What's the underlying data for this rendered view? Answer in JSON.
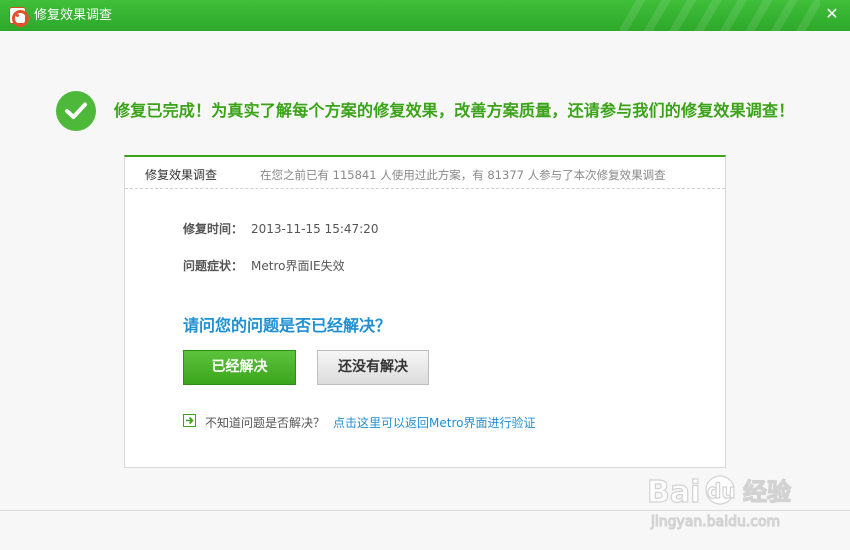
{
  "window": {
    "title": "修复效果调查",
    "close_glyph": "✕"
  },
  "banner": {
    "message": "修复已完成！为真实了解每个方案的修复效果，改善方案质量，还请参与我们的修复效果调查！"
  },
  "survey": {
    "title": "修复效果调查",
    "stats": "在您之前已有 115841 人使用过此方案，有 81377 人参与了本次修复效果调查",
    "repair_time_label": "修复时间：",
    "repair_time_value": "2013-11-15 15:47:20",
    "symptom_label": "问题症状：",
    "symptom_value": "Metro界面IE失效",
    "question": "请问您的问题是否已经解决？",
    "solved_button": "已经解决",
    "not_solved_button": "还没有解决",
    "help_text": "不知道问题是否解决？",
    "help_link": "点击这里可以返回Metro界面进行验证"
  },
  "colors": {
    "title_bar": "#33b02e",
    "success_green": "#3aa318",
    "link_blue": "#1f8fd4"
  },
  "icons": {
    "app": "lifebuoy-icon",
    "success": "checkmark-circle-icon",
    "help": "arrow-right-icon"
  }
}
